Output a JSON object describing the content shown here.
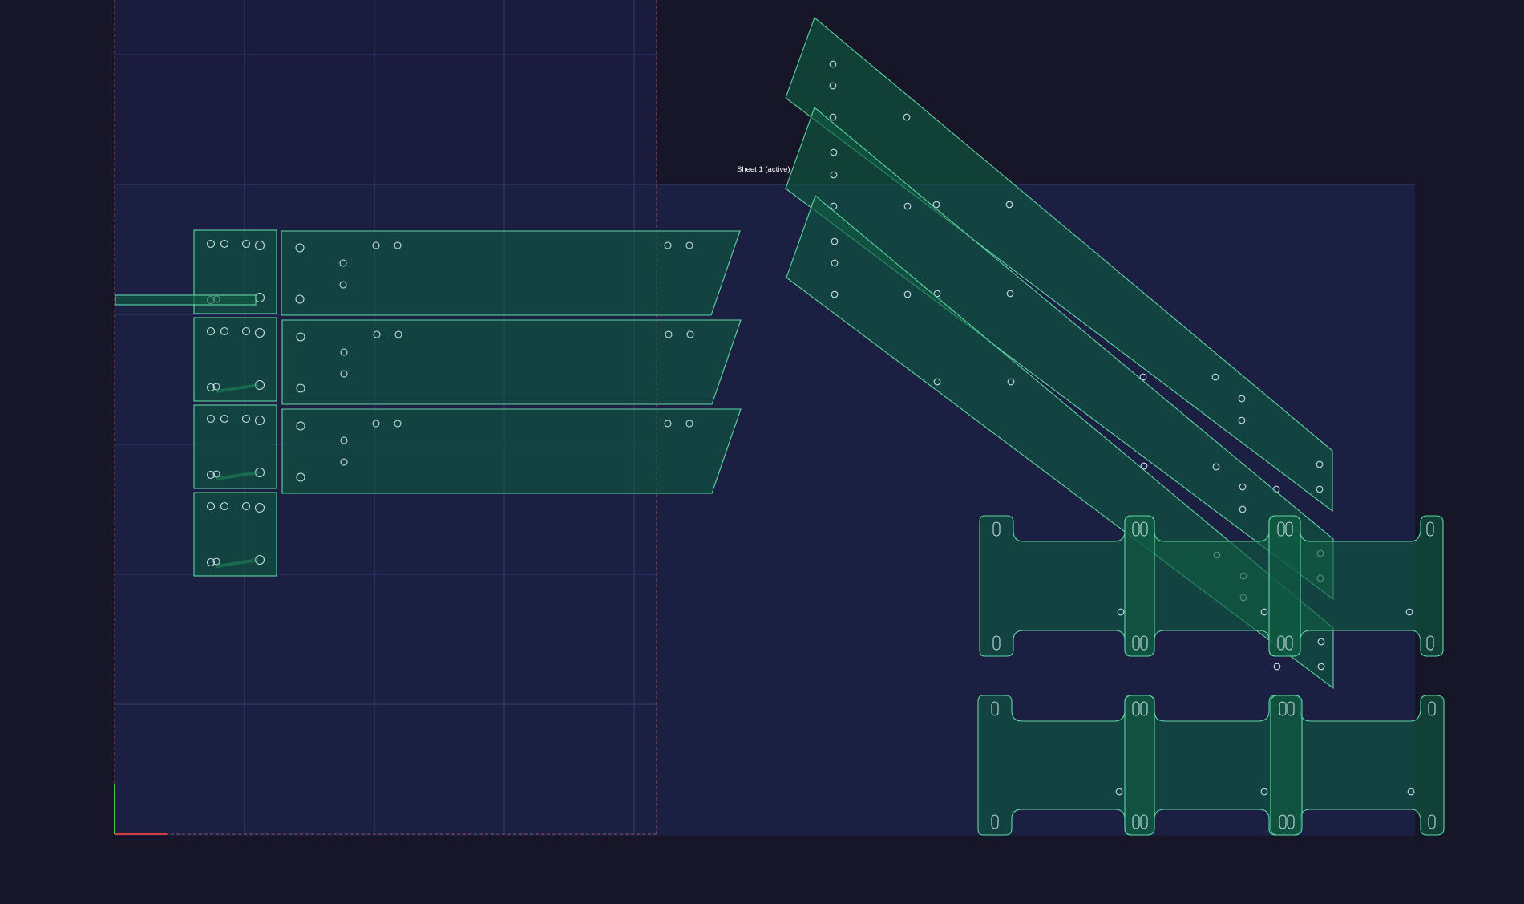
{
  "sheet": {
    "label": "Sheet 1 (active)"
  },
  "colors": {
    "background": "#161628",
    "sheet_fill": "#1b1f42",
    "stock_fill": "#1a1b3d",
    "part_fill": "#0f5a40",
    "part_stroke": "#5fd6a2",
    "hole_stroke": "#c9dbe6",
    "grid_line": "#3a4680",
    "sheet_border_dashed": "#a0505e",
    "axis_x": "#d23c3c",
    "axis_y": "#4fbf4f"
  },
  "icons": {
    "parts": "nested-part-outline",
    "holes": "mounting-hole-circle",
    "slots": "slot-outline"
  }
}
